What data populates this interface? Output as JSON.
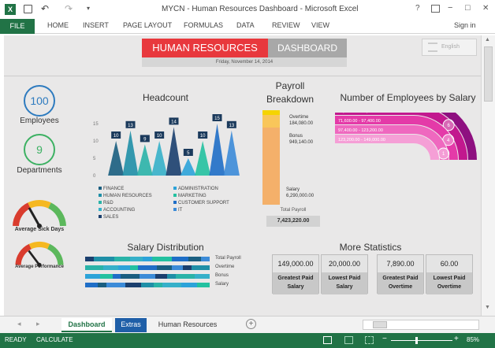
{
  "window": {
    "title": "MYCN - Human Resources Dashboard - Microsoft Excel",
    "help": "?",
    "min": "−",
    "max": "□",
    "close": "✕"
  },
  "ribbon": {
    "file": "FILE",
    "tabs": [
      "HOME",
      "INSERT",
      "PAGE LAYOUT",
      "FORMULAS",
      "DATA",
      "REVIEW",
      "VIEW"
    ],
    "signin": "Sign in"
  },
  "dash": {
    "title": "HUMAN RESOURCES",
    "subtitle": "DASHBOARD",
    "date": "Friday, November 14, 2014",
    "lang": "English",
    "employees_value": "100",
    "employees_label": "Employees",
    "departments_value": "9",
    "departments_label": "Departments",
    "gauge1_label": "Average Sick Days",
    "gauge2_label": "Average Performance",
    "accent_colors": {
      "red": "#e8383d",
      "green": "#3db163",
      "blue": "#2e7bbf",
      "purple": "#8e1080"
    }
  },
  "chart_data": [
    {
      "type": "bar",
      "title": "Headcount",
      "categories": [
        "FINANCE",
        "HUMAN RESOURCES",
        "R&D",
        "ACCOUNTING",
        "SALES",
        "ADMINISTRATION",
        "MARKETING",
        "CUSTOMER SUPPORT",
        "IT"
      ],
      "values": [
        10,
        13,
        9,
        10,
        14,
        5,
        10,
        15,
        13
      ],
      "colors": [
        "#1a5e80",
        "#1f8fa7",
        "#2ab3a8",
        "#36b0c9",
        "#1b3f6e",
        "#2ca3d9",
        "#23c1a0",
        "#1f6ec7",
        "#3c8bd8"
      ],
      "ylim": [
        0,
        15
      ],
      "yticks": [
        "15",
        "10",
        "5",
        "0"
      ]
    },
    {
      "type": "bar",
      "title": "Payroll Breakdown",
      "categories": [
        "Overtime",
        "Bonus",
        "Salary"
      ],
      "values": [
        184080,
        949140,
        6290000
      ],
      "labels": [
        "Overtime\n184,080.00",
        "Bonus\n949,140.00",
        "Salary\n6,290,000.00"
      ],
      "total_label": "Total Payroll",
      "total_value": "7,423,220.00"
    },
    {
      "type": "bar",
      "title": "Number of Employees by Salary",
      "ranges": [
        "20,000.00 - 45,800.00",
        "45,800.00 - 71,600.00",
        "71,600.00 - 97,400.00",
        "97,400.00 - 123,200.00",
        "123,200.00 - 149,000.00"
      ],
      "values": [
        25,
        6,
        4,
        1,
        1
      ],
      "value_labels": [
        "25",
        "6",
        "4",
        "1",
        ""
      ]
    },
    {
      "type": "bar",
      "title": "Salary Distribution",
      "series": [
        "Total Payroll",
        "Overtime",
        "Bonus",
        "Salary"
      ]
    }
  ],
  "stats": {
    "title": "More Statistics",
    "cells": [
      {
        "value": "149,000.00",
        "label": "Greatest Paid Salary"
      },
      {
        "value": "20,000.00",
        "label": "Lowest Paid Salary"
      },
      {
        "value": "7,890.00",
        "label": "Greatest Paid Overtime"
      },
      {
        "value": "60.00",
        "label": "Lowest Paid Overtime"
      }
    ]
  },
  "sheets": {
    "tabs": [
      "Dashboard",
      "Extras",
      "Human Resources"
    ],
    "add": "+"
  },
  "status": {
    "ready": "READY",
    "calc": "CALCULATE",
    "zoom": "85%"
  }
}
